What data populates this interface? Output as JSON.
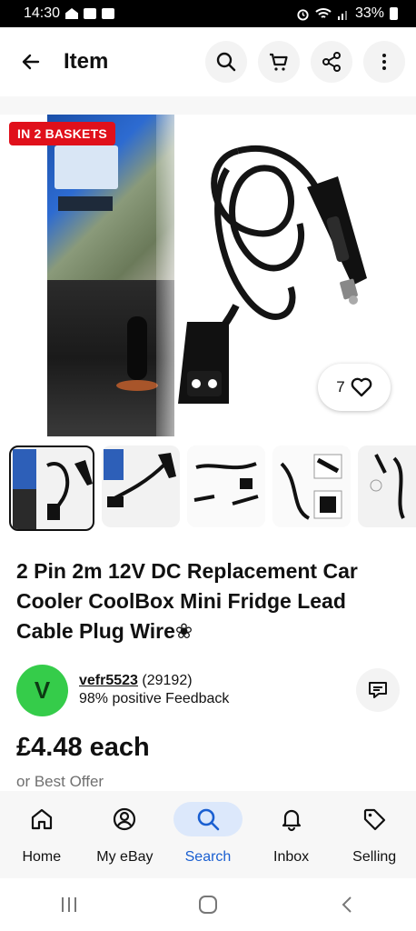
{
  "status_bar": {
    "time": "14:30",
    "battery": "33%"
  },
  "header": {
    "title": "Item"
  },
  "hero": {
    "badge": "IN 2 BASKETS",
    "watch_count": "7"
  },
  "listing": {
    "title": "2 Pin 2m 12V DC Replacement Car Cooler CoolBox Mini Fridge Lead Cable Plug Wire❀",
    "price": "£4.48 each",
    "best_offer": "or Best Offer"
  },
  "seller": {
    "avatar_letter": "V",
    "name": "vefr5523",
    "score": "(29192)",
    "feedback": "98% positive Feedback"
  },
  "bottom_nav": {
    "items": [
      {
        "label": "Home",
        "icon": "home-icon"
      },
      {
        "label": "My eBay",
        "icon": "user-circle-icon"
      },
      {
        "label": "Search",
        "icon": "search-icon",
        "active": true
      },
      {
        "label": "Inbox",
        "icon": "bell-icon"
      },
      {
        "label": "Selling",
        "icon": "tag-icon"
      }
    ]
  },
  "colors": {
    "badge_bg": "#e0101b",
    "avatar_bg": "#35cc4a",
    "active_nav": "#1a5fd1",
    "active_nav_bg": "#dce8fb"
  }
}
